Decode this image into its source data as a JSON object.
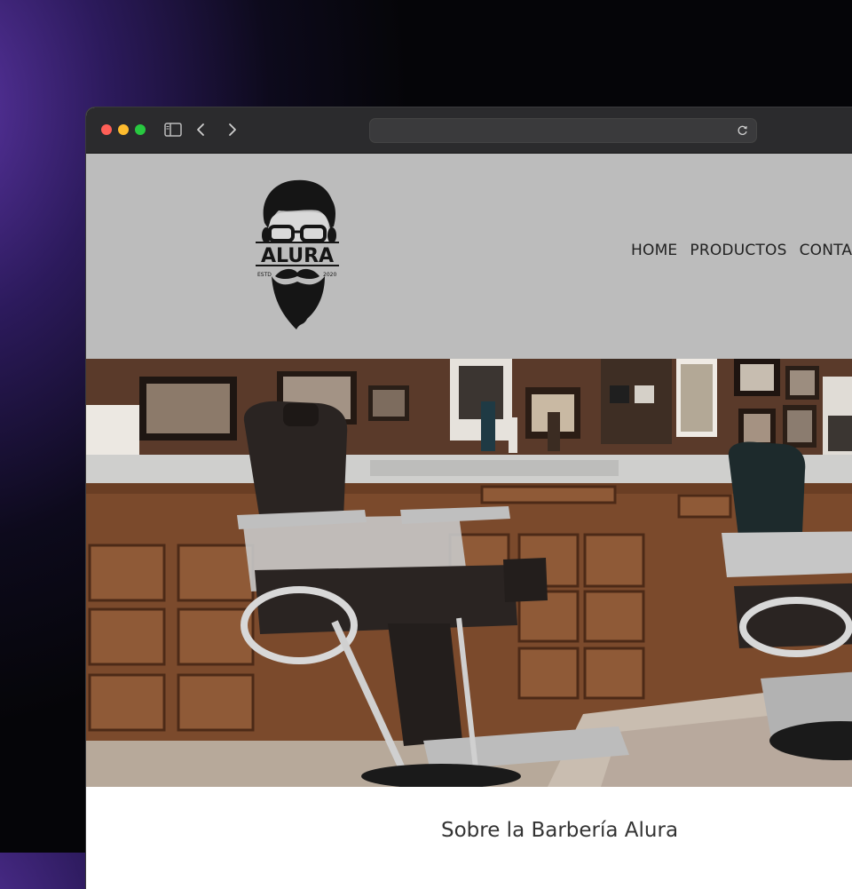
{
  "browser": {
    "address": ""
  },
  "site": {
    "logo": {
      "brand": "ALURA",
      "estd_left": "ESTD",
      "estd_right": "2020"
    },
    "nav": [
      "HOME",
      "PRODUCTOS",
      "CONTACTO"
    ],
    "hero": {
      "image": "barbershop-interior-with-chairs"
    },
    "about": {
      "title": "Sobre la Barbería Alura"
    }
  },
  "colors": {
    "header_bg": "#bcbcbc",
    "toolbar_bg": "#2b2b2d",
    "chair_leather": "#2a2422",
    "wood": "#7b4a2c"
  }
}
